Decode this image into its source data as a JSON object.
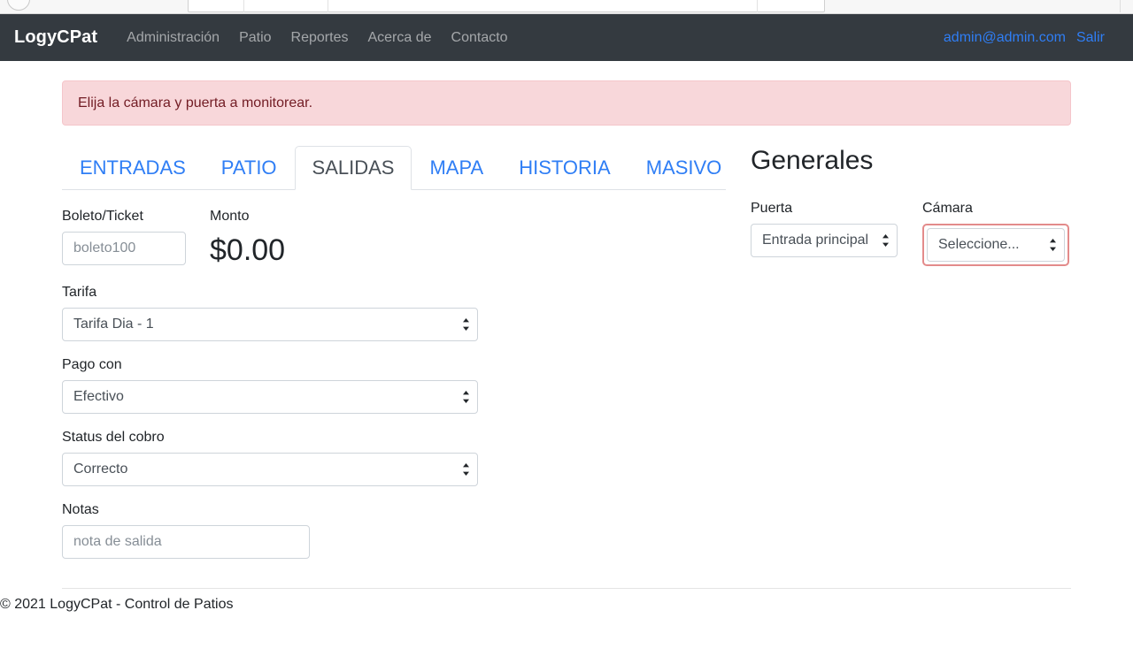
{
  "browser": {
    "chrome_visible": true
  },
  "navbar": {
    "brand": "LogyCPat",
    "links": [
      {
        "label": "Administración",
        "name": "nav-link-administracion"
      },
      {
        "label": "Patio",
        "name": "nav-link-patio"
      },
      {
        "label": "Reportes",
        "name": "nav-link-reportes"
      },
      {
        "label": "Acerca de",
        "name": "nav-link-acerca-de"
      },
      {
        "label": "Contacto",
        "name": "nav-link-contacto"
      }
    ],
    "user_email": "admin@admin.com",
    "logout_label": "Salir",
    "background_color": "#343a40",
    "link_color": "#2f7ef5"
  },
  "alert": {
    "message": "Elija la cámara y puerta a monitorear.",
    "type": "danger",
    "background_color": "#f8d7da",
    "border_color": "#f5c6cb",
    "text_color": "#721c24"
  },
  "tabs": [
    {
      "label": "ENTRADAS",
      "active": false
    },
    {
      "label": "PATIO",
      "active": false
    },
    {
      "label": "SALIDAS",
      "active": true
    },
    {
      "label": "MAPA",
      "active": false
    },
    {
      "label": "HISTORIA",
      "active": false
    },
    {
      "label": "MASIVO",
      "active": false
    }
  ],
  "form": {
    "boleto": {
      "label": "Boleto/Ticket",
      "placeholder": "boleto100",
      "value": ""
    },
    "monto": {
      "label": "Monto",
      "value": "$0.00"
    },
    "tarifa": {
      "label": "Tarifa",
      "selected": "Tarifa Dia - 1"
    },
    "pago_con": {
      "label": "Pago con",
      "selected": "Efectivo"
    },
    "status_cobro": {
      "label": "Status del cobro",
      "selected": "Correcto"
    },
    "notas": {
      "label": "Notas",
      "placeholder": "nota de salida",
      "value": ""
    }
  },
  "generales": {
    "title": "Generales",
    "puerta": {
      "label": "Puerta",
      "selected": "Entrada principal"
    },
    "camara": {
      "label": "Cámara",
      "selected": "Seleccione...",
      "invalid": true,
      "invalid_border_color": "#e38b8b"
    }
  },
  "footer": {
    "text": "© 2021 LogyCPat - Control de Patios"
  }
}
